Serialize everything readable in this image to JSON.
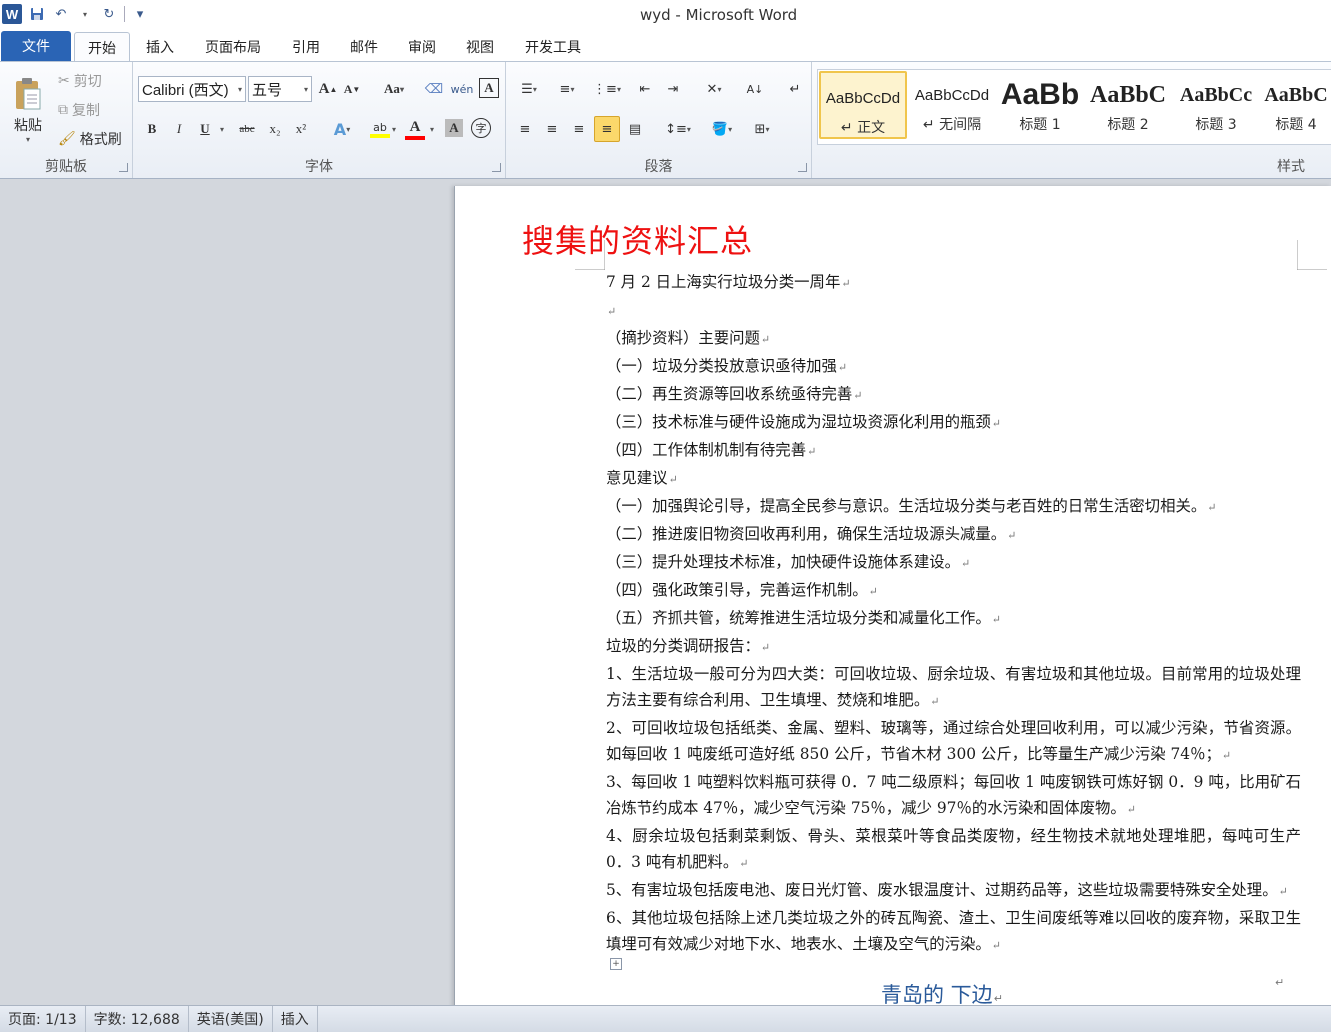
{
  "window": {
    "title": "wyd - Microsoft Word",
    "app_logo": "W"
  },
  "quick_access": [
    {
      "name": "save-icon",
      "glyph": "💾"
    },
    {
      "name": "undo-icon",
      "glyph": "↶"
    },
    {
      "name": "redo-icon",
      "glyph": "↻"
    },
    {
      "name": "customize-icon",
      "glyph": "▾"
    }
  ],
  "tabs": [
    "文件",
    "开始",
    "插入",
    "页面布局",
    "引用",
    "邮件",
    "审阅",
    "视图",
    "开发工具"
  ],
  "active_tab": "开始",
  "clipboard": {
    "label": "剪贴板",
    "paste": "粘贴",
    "cut": "剪切",
    "copy": "复制",
    "format_painter": "格式刷"
  },
  "font": {
    "label": "字体",
    "font_name": "Calibri (西文)",
    "font_size": "五号",
    "grow": "A",
    "shrink": "A",
    "change_case": "Aa",
    "bold": "B",
    "italic": "I",
    "underline": "U",
    "strike": "abc",
    "subscript": "x₂",
    "superscript": "x²"
  },
  "paragraph": {
    "label": "段落"
  },
  "styles": {
    "label": "样式",
    "items": [
      {
        "sample": "AaBbCcDd",
        "name": "↵ 正文",
        "size": "15px",
        "weight": "normal"
      },
      {
        "sample": "AaBbCcDd",
        "name": "↵ 无间隔",
        "size": "15px",
        "weight": "normal"
      },
      {
        "sample": "AaBb",
        "name": "标题 1",
        "size": "30px",
        "weight": "bold"
      },
      {
        "sample": "AaBbC",
        "name": "标题 2",
        "size": "24px",
        "weight": "bold"
      },
      {
        "sample": "AaBbCc",
        "name": "标题 3",
        "size": "20px",
        "weight": "bold"
      },
      {
        "sample": "AaBbC",
        "name": "标题 4",
        "size": "20px",
        "weight": "bold"
      }
    ]
  },
  "document": {
    "title": "搜集的资料汇总",
    "paragraphs": [
      "7 月 2 日上海实行垃圾分类一周年",
      "",
      "（摘抄资料）主要问题",
      "（一）垃圾分类投放意识亟待加强",
      "（二）再生资源等回收系统亟待完善",
      "（三）技术标准与硬件设施成为湿垃圾资源化利用的瓶颈",
      "（四）工作体制机制有待完善",
      "意见建议",
      "（一）加强舆论引导，提高全民参与意识。生活垃圾分类与老百姓的日常生活密切相关。",
      "（二）推进废旧物资回收再利用，确保生活垃圾源头减量。",
      "（三）提升处理技术标准，加快硬件设施体系建设。",
      "（四）强化政策引导，完善运作机制。",
      "（五）齐抓共管，统筹推进生活垃圾分类和减量化工作。",
      "垃圾的分类调研报告：",
      "1、生活垃圾一般可分为四大类：可回收垃圾、厨余垃圾、有害垃圾和其他垃圾。目前常用的垃圾处理方法主要有综合利用、卫生填埋、焚烧和堆肥。",
      "2、可回收垃圾包括纸类、金属、塑料、玻璃等，通过综合处理回收利用，可以减少污染，节省资源。如每回收 1 吨废纸可造好纸 850 公斤，节省木材 300 公斤，比等量生产减少污染 74％；",
      "3、每回收 1 吨塑料饮料瓶可获得 0．7 吨二级原料；每回收 1 吨废钢铁可炼好钢 0．9 吨，比用矿石冶炼节约成本 47％，减少空气污染 75％，减少 97％的水污染和固体废物。",
      "4、厨余垃圾包括剩菜剩饭、骨头、菜根菜叶等食品类废物，经生物技术就地处理堆肥，每吨可生产 0．3 吨有机肥料。",
      "5、有害垃圾包括废电池、废日光灯管、废水银温度计、过期药品等，这些垃圾需要特殊安全处理。",
      "6、其他垃圾包括除上述几类垃圾之外的砖瓦陶瓷、渣土、卫生间废纸等难以回收的废弃物，采取卫生填埋可有效减少对地下水、地表水、土壤及空气的污染。"
    ],
    "subheading": "青岛的 下边",
    "paragraph_mark": "↵"
  },
  "status": {
    "page": "页面: 1/13",
    "words": "字数: 12,688",
    "language": "英语(美国)",
    "mode": "插入"
  }
}
